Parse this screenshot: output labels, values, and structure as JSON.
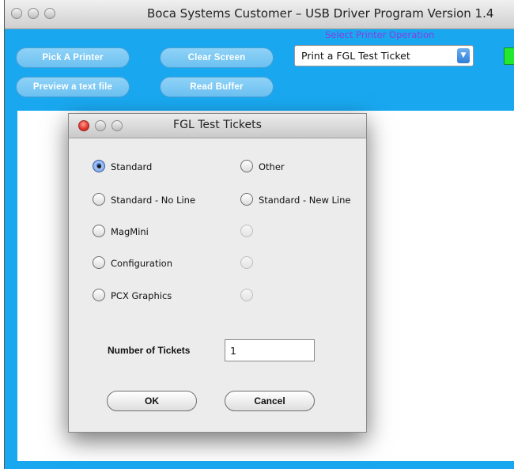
{
  "window": {
    "title": "Boca Systems Customer – USB Driver Program Version 1.4"
  },
  "toolbar": {
    "pick_printer": "Pick A Printer",
    "clear_screen": "Clear Screen",
    "preview_text": "Preview a text file",
    "read_buffer": "Read Buffer"
  },
  "operation": {
    "label": "Select Printer Operation",
    "selected": "Print a FGL Test Ticket"
  },
  "status": {
    "color": "#22e830"
  },
  "dialog": {
    "title": "FGL Test Tickets",
    "options": {
      "standard": "Standard",
      "other": "Other",
      "standard_no_line": "Standard - No Line",
      "standard_new_line": "Standard - New Line",
      "magmini": "MagMini",
      "configuration": "Configuration",
      "pcx_graphics": "PCX Graphics"
    },
    "selected_option": "Standard",
    "num_tickets_label": "Number of Tickets",
    "num_tickets_value": "1",
    "ok_label": "OK",
    "cancel_label": "Cancel"
  }
}
